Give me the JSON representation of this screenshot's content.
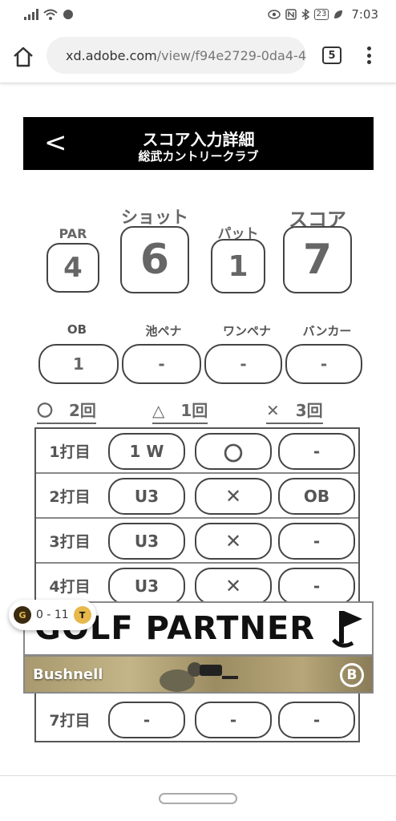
{
  "status_bar": {
    "battery": "23",
    "time": "7:03"
  },
  "browser": {
    "url_host": "xd.adobe.com",
    "url_path": "/view/f94e2729-0da4-4",
    "tab_count": "5"
  },
  "header": {
    "back_label": "<",
    "title": "スコア入力詳細",
    "subtitle": "総武カントリークラブ"
  },
  "stats": {
    "par_label": "PAR",
    "par_value": "4",
    "shot_label": "ショット",
    "shot_value": "6",
    "putt_label": "パット",
    "putt_value": "1",
    "score_label": "スコア",
    "score_value": "7"
  },
  "penalties": [
    {
      "label": "OB",
      "value": "1"
    },
    {
      "label": "池ペナ",
      "value": "-"
    },
    {
      "label": "ワンペナ",
      "value": "-"
    },
    {
      "label": "バンカー",
      "value": "-"
    }
  ],
  "summary": [
    {
      "text": "〇　2回"
    },
    {
      "text": "△　1回"
    },
    {
      "text": "✕　3回"
    }
  ],
  "shots": [
    {
      "label": "1打目",
      "club": "1 W",
      "result": "〇",
      "penalty": "-"
    },
    {
      "label": "2打目",
      "club": "U3",
      "result": "✕",
      "penalty": "OB"
    },
    {
      "label": "3打目",
      "club": "U3",
      "result": "✕",
      "penalty": "-"
    },
    {
      "label": "4打目",
      "club": "U3",
      "result": "✕",
      "penalty": "-"
    },
    {
      "label": "7打目",
      "club": "-",
      "result": "-",
      "penalty": "-"
    }
  ],
  "ads": {
    "golf_partner": "GOLF PARTNER",
    "bushnell": "Bushnell",
    "bushnell_logo": "B"
  },
  "score_chip": {
    "text": "0 - 11"
  }
}
